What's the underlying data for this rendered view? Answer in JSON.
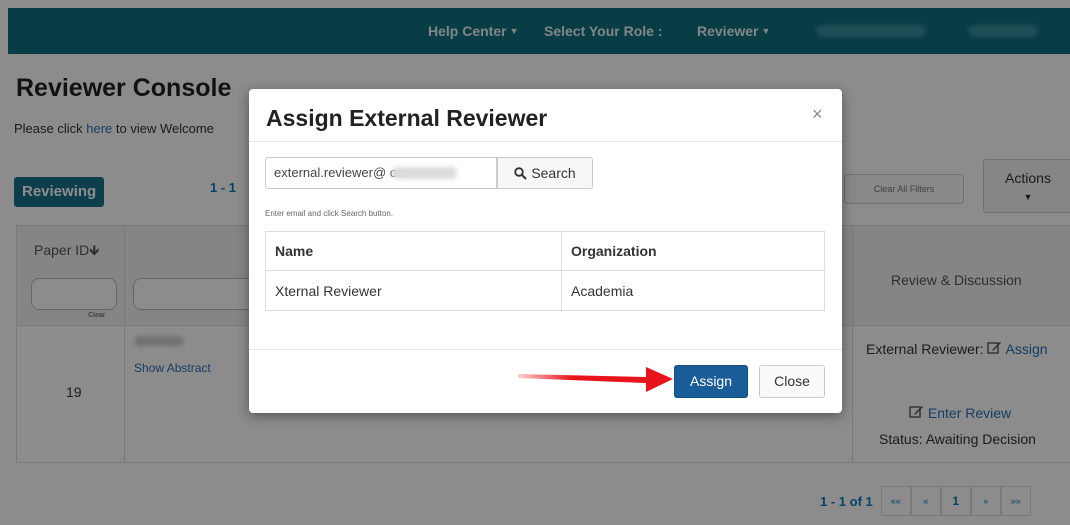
{
  "navbar": {
    "help_center": "Help Center",
    "select_role_label": "Select Your Role :",
    "role": "Reviewer"
  },
  "page": {
    "title": "Reviewer Console",
    "welcome_prefix": "Please click ",
    "welcome_link": "here",
    "welcome_suffix": " to view Welcome",
    "tab_reviewing": "Reviewing",
    "count_top": "1 - 1",
    "clear_all_filters": "Clear All Filters",
    "actions": "Actions"
  },
  "table": {
    "col_paper_id": "Paper ID",
    "col_review": "Review & Discussion",
    "clear_label": "Clear",
    "row": {
      "paper_id": "19",
      "show_abstract": "Show Abstract",
      "external_reviewer_label": "External Reviewer:",
      "assign_link": "Assign",
      "enter_review": "Enter Review",
      "status": "Status: Awaiting Decision"
    }
  },
  "pagination": {
    "count": "1 - 1 of 1",
    "first": "««",
    "prev": "«",
    "page": "1",
    "next": "»",
    "last": "»»"
  },
  "modal": {
    "title": "Assign External Reviewer",
    "close_icon": "×",
    "search_value": "external.reviewer@            om",
    "search_button": "Search",
    "hint": "Enter email and click Search button.",
    "columns": [
      "Name",
      "Organization"
    ],
    "result": {
      "name": "Xternal Reviewer",
      "organization": "Academia"
    },
    "assign_button": "Assign",
    "close_button": "Close"
  },
  "colors": {
    "navbar": "#0f6f80",
    "primary_button": "#1a5c97",
    "arrow": "#e8141b"
  }
}
